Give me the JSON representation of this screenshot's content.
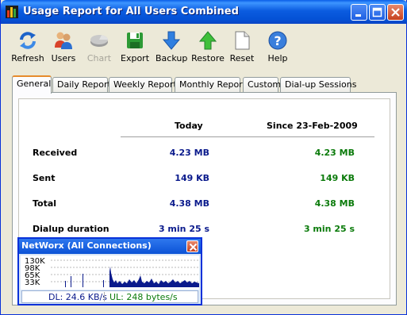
{
  "window": {
    "title": "Usage Report for All Users Combined"
  },
  "toolbar": {
    "items": [
      {
        "label": "Refresh",
        "icon": "refresh-icon",
        "enabled": true
      },
      {
        "label": "Users",
        "icon": "users-icon",
        "enabled": true
      },
      {
        "label": "Chart",
        "icon": "chart-icon",
        "enabled": false
      },
      {
        "label": "Export",
        "icon": "save-disk-icon",
        "enabled": true
      },
      {
        "label": "Backup",
        "icon": "down-arrow-icon",
        "enabled": true
      },
      {
        "label": "Restore",
        "icon": "up-arrow-icon",
        "enabled": true
      },
      {
        "label": "Reset",
        "icon": "blank-page-icon",
        "enabled": true
      },
      {
        "label": "Help",
        "icon": "help-icon",
        "enabled": true
      }
    ]
  },
  "tabs": [
    {
      "label": "General",
      "active": true
    },
    {
      "label": "Daily Report",
      "active": false
    },
    {
      "label": "Weekly Report",
      "active": false
    },
    {
      "label": "Monthly Report",
      "active": false
    },
    {
      "label": "Custom",
      "active": false
    },
    {
      "label": "Dial-up Sessions",
      "active": false
    }
  ],
  "summary": {
    "col_today": "Today",
    "col_since": "Since 23-Feb-2009",
    "rows": [
      {
        "label": "Received",
        "today": "4.23 MB",
        "since": "4.23 MB"
      },
      {
        "label": "Sent",
        "today": "149 KB",
        "since": "149 KB"
      },
      {
        "label": "Total",
        "today": "4.38 MB",
        "since": "4.38 MB"
      },
      {
        "label": "Dialup duration",
        "today": "3 min 25 s",
        "since": "3 min 25 s"
      }
    ]
  },
  "mini": {
    "title": "NetWorx (All Connections)",
    "y_labels": [
      "130K",
      "98K",
      "65K",
      "33K"
    ],
    "dl": "DL: 24.6 KB/s",
    "ul": "UL: 248 bytes/s"
  },
  "colors": {
    "today_value": "#0a1a8c",
    "since_value": "#0b7b0b",
    "titlebar": "#0b5ce0",
    "graph_fill": "#0a1a8c"
  }
}
